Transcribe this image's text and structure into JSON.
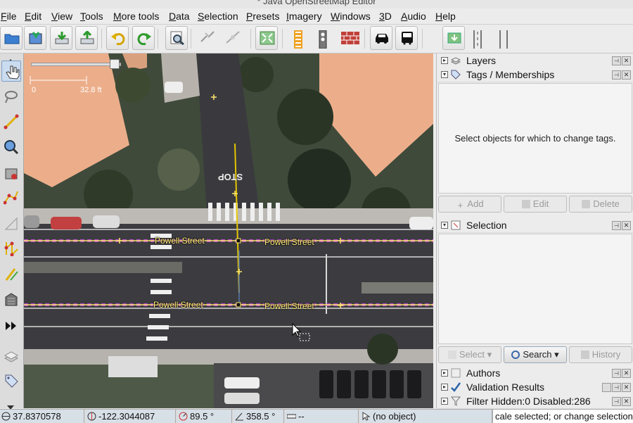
{
  "window": {
    "title": "* Java OpenStreetMap Editor"
  },
  "menu": [
    {
      "mnemonic": "F",
      "rest": "ile"
    },
    {
      "mnemonic": "E",
      "rest": "dit"
    },
    {
      "mnemonic": "V",
      "rest": "iew"
    },
    {
      "mnemonic": "T",
      "rest": "ools"
    },
    {
      "mnemonic": "M",
      "rest": "ore tools"
    },
    {
      "mnemonic": "D",
      "rest": "ata"
    },
    {
      "mnemonic": "S",
      "rest": "election"
    },
    {
      "mnemonic": "P",
      "rest": "resets"
    },
    {
      "mnemonic": "I",
      "rest": "magery"
    },
    {
      "mnemonic": "W",
      "rest": "indows"
    },
    {
      "mnemonic": "3",
      "rest": "D"
    },
    {
      "mnemonic": "A",
      "rest": "udio"
    },
    {
      "mnemonic": "H",
      "rest": "elp"
    }
  ],
  "map": {
    "scale_zero": "0",
    "scale_label": "32.8 ft",
    "street_label": "Powell Street",
    "road_marking": "STOP"
  },
  "panels": {
    "layers": {
      "title": "Layers"
    },
    "tags": {
      "title": "Tags / Memberships",
      "empty_message": "Select objects for which to change tags.",
      "add_label": "Add",
      "edit_label": "Edit",
      "delete_label": "Delete"
    },
    "selection": {
      "title": "Selection",
      "select_label": "Select",
      "search_label": "Search",
      "history_label": "History"
    },
    "authors": {
      "title": "Authors"
    },
    "validation": {
      "title": "Validation Results"
    },
    "filter": {
      "title": "Filter Hidden:0 Disabled:286"
    }
  },
  "status": {
    "lat": "37.8370578",
    "lon": "-122.3044087",
    "heading": "89.5 °",
    "angle": "358.5 °",
    "distance": "--",
    "object": "(no object)",
    "help_text": "cale selected; or change selection"
  },
  "colors": {
    "selection_highlight": "#cbdcf0",
    "way_highlight": "#b44ad0",
    "street_label": "#ffec7a",
    "roof": "#ecae8a"
  }
}
